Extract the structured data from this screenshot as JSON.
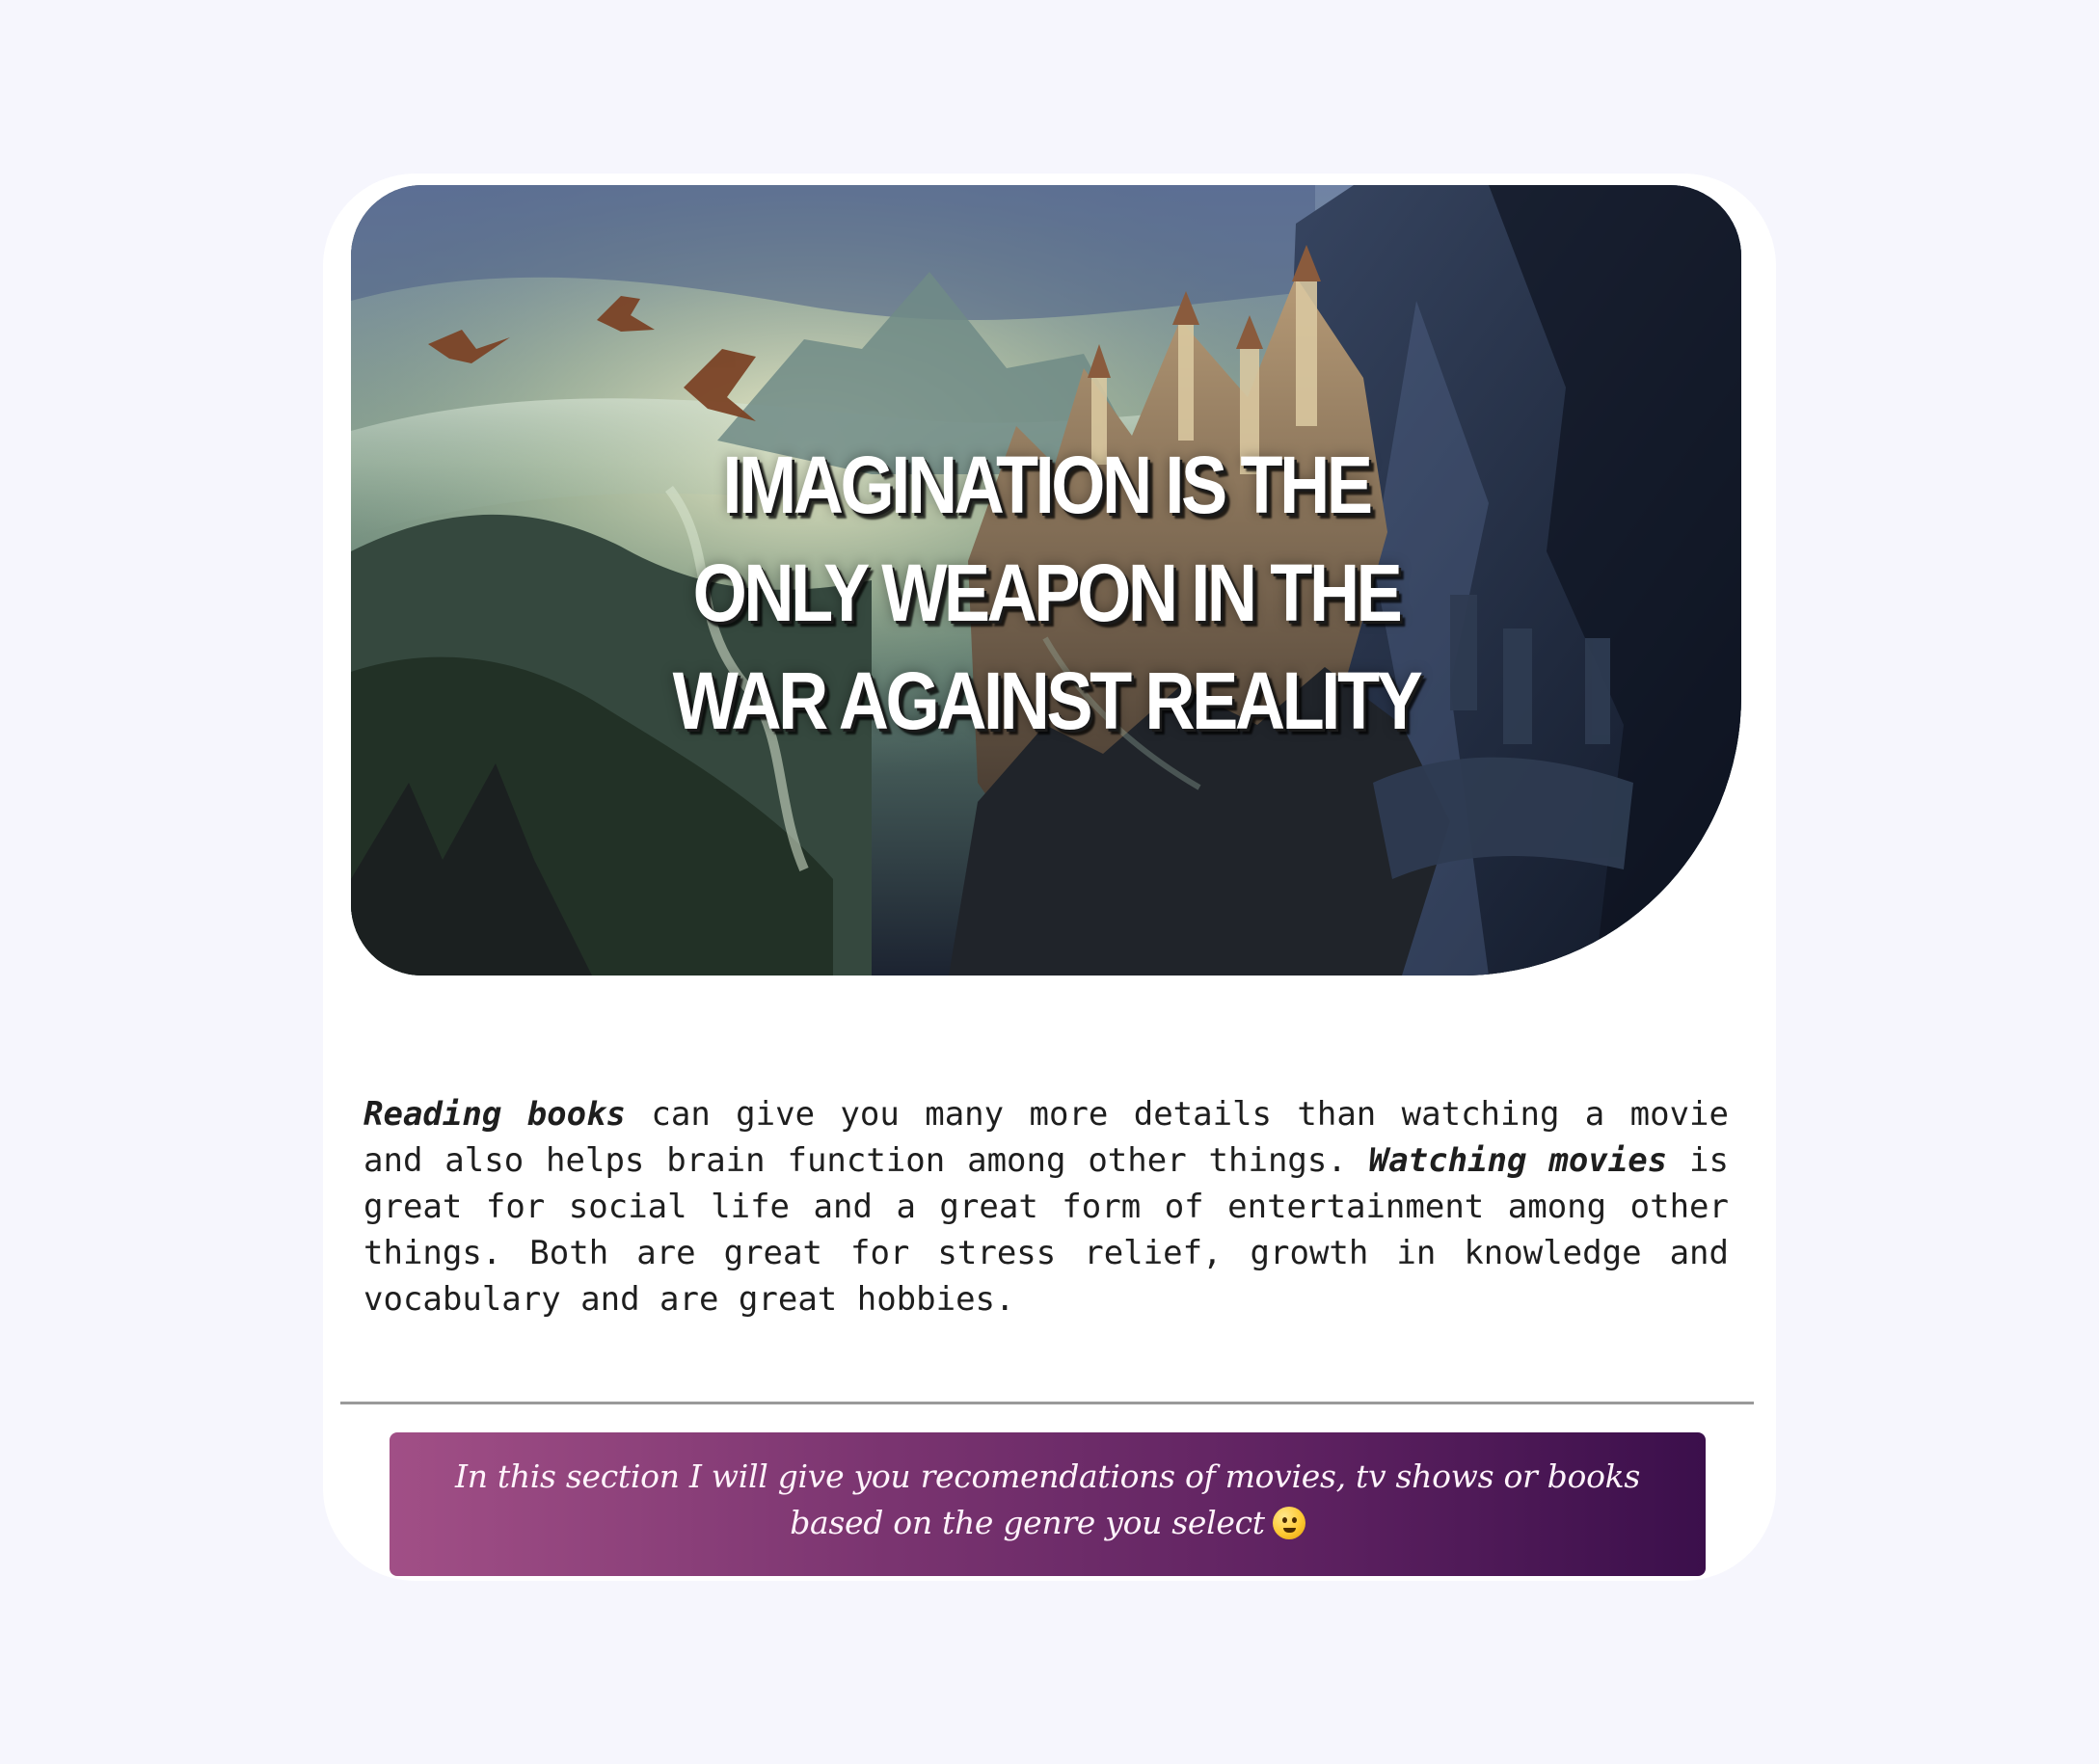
{
  "hero": {
    "quote_lines": [
      "IMAGINATION IS THE",
      "ONLY WEAPON IN THE",
      "WAR AGAINST REALITY"
    ]
  },
  "intro": {
    "reading_label": "Reading books",
    "reading_text": " can give you many more details than watching a movie and also helps brain function among other things. ",
    "movies_label": "Watching movies",
    "movies_text": " is great for social life and a great form of entertainment among other things. Both are great for stress relief, growth in knowledge and vocabulary and are great hobbies."
  },
  "banner": {
    "text": "In this section I will give you recomendations of movies, tv shows or books based on the genre you select",
    "emoji": "smiling-face-emoji"
  },
  "colors": {
    "page_background": "#f6f6fd",
    "card_background": "#ffffff",
    "banner_start": "#a14f86",
    "banner_end": "#3b0f4b",
    "text": "#1e1e1e"
  }
}
